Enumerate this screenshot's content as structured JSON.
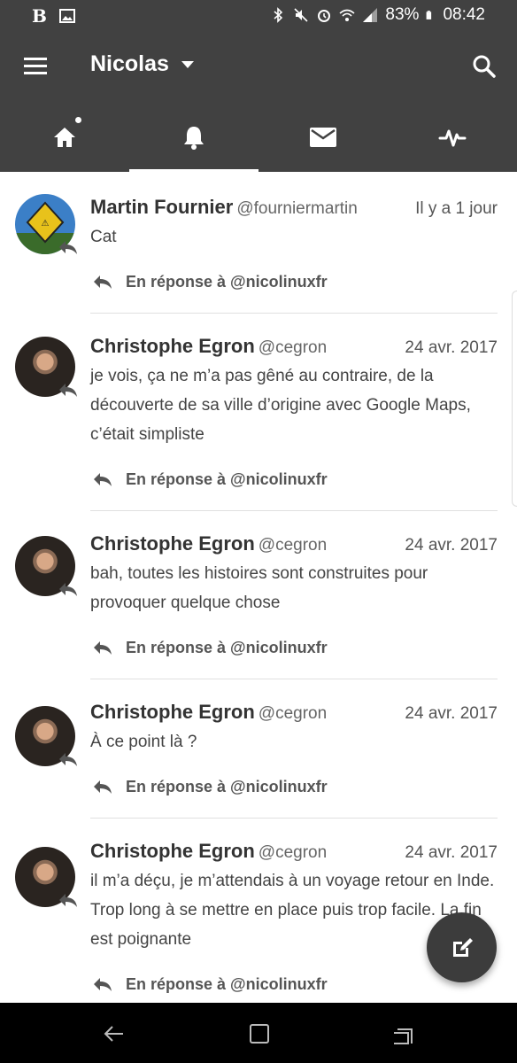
{
  "status_bar": {
    "battery": "83%",
    "time": "08:42"
  },
  "app_bar": {
    "account_name": "Nicolas",
    "icons": [
      "menu-icon",
      "search-icon"
    ]
  },
  "tabs": [
    {
      "icon": "home-icon",
      "active": false,
      "has_dot": true
    },
    {
      "icon": "bell-icon",
      "active": true,
      "has_dot": false
    },
    {
      "icon": "mail-icon",
      "active": false,
      "has_dot": false
    },
    {
      "icon": "activity-icon",
      "active": false,
      "has_dot": false
    }
  ],
  "feed": [
    {
      "name": "Martin Fournier",
      "handle": "@fourniermartin",
      "time": "Il y a 1 jour",
      "text": "Cat",
      "reply": "En réponse à @nicolinuxfr"
    },
    {
      "name": "Christophe Egron",
      "handle": "@cegron",
      "time": "24 avr. 2017",
      "text": "je vois, ça ne m’a pas gêné au contraire, de la découverte de sa ville d’origine avec Google Maps, c’était simpliste",
      "reply": "En réponse à @nicolinuxfr"
    },
    {
      "name": "Christophe Egron",
      "handle": "@cegron",
      "time": "24 avr. 2017",
      "text": "bah, toutes les histoires sont construites pour provoquer quelque chose",
      "reply": "En réponse à @nicolinuxfr"
    },
    {
      "name": "Christophe Egron",
      "handle": "@cegron",
      "time": "24 avr. 2017",
      "text": "À ce point là ?",
      "reply": "En réponse à @nicolinuxfr"
    },
    {
      "name": "Christophe Egron",
      "handle": "@cegron",
      "time": "24 avr. 2017",
      "text": "il m’a déçu, je m’attendais à un voyage retour en Inde. Trop long à se mettre en place puis trop facile. La fin est poignante",
      "reply": "En réponse à @nicolinuxfr"
    }
  ],
  "fab": {
    "icon": "compose-icon"
  },
  "nav_bar": {
    "icons": [
      "back-icon",
      "home-square-icon",
      "recents-icon"
    ]
  }
}
